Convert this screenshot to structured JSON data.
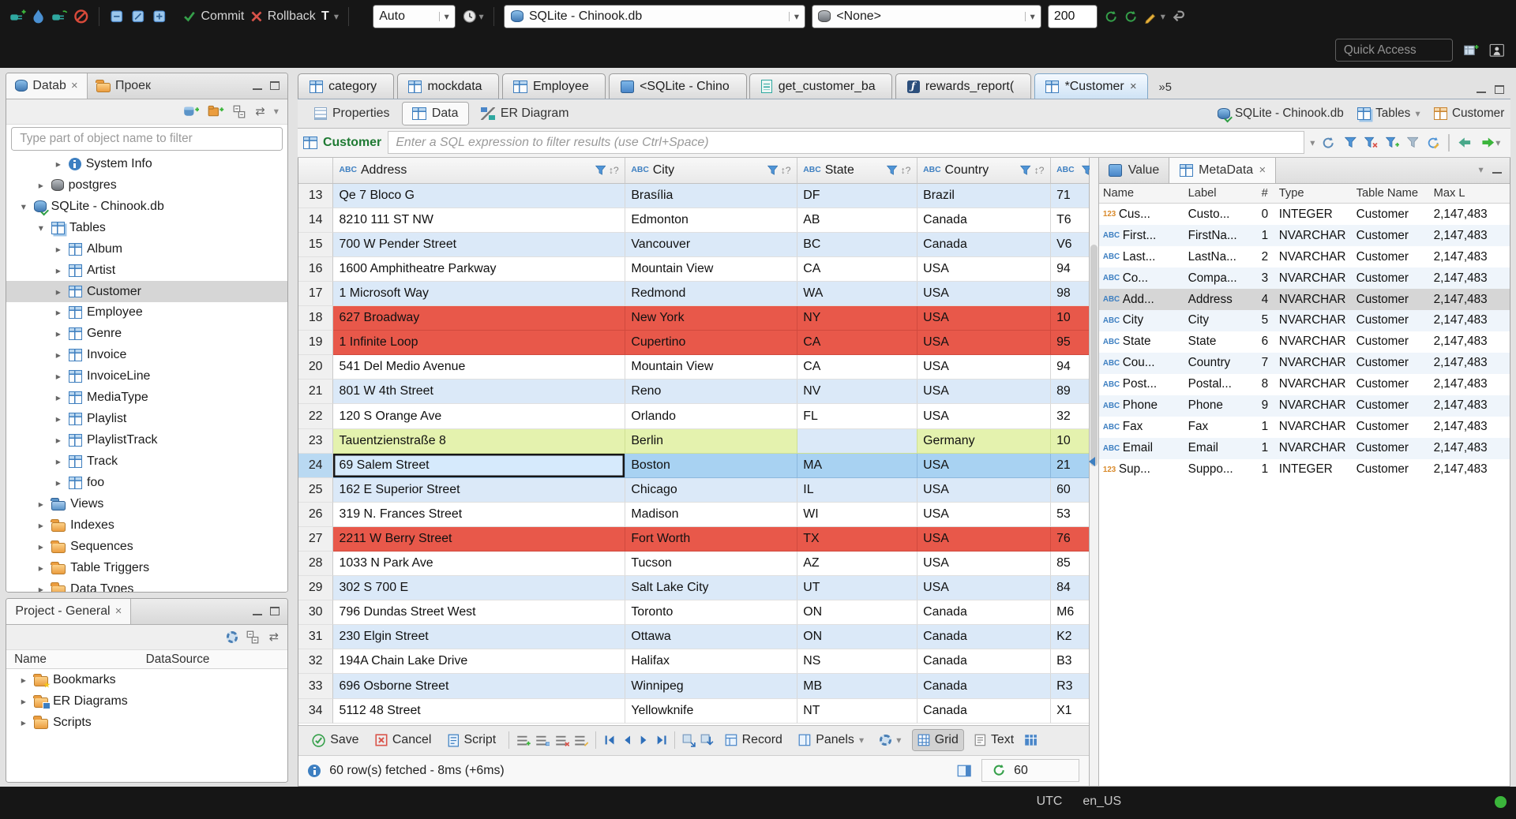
{
  "icons": {
    "chevron": "▾",
    "close": "×",
    "sort": "↕?",
    "link": "⇄"
  },
  "topbar": {
    "commit": "Commit",
    "rollback": "Rollback",
    "txn_letter": "T",
    "auto": "Auto",
    "db_combo": "SQLite - Chinook.db",
    "schema_combo": "<None>",
    "fetch_size": "200",
    "quick_access": "Quick Access"
  },
  "navigator": {
    "tab_database": "Datab",
    "tab_projects": "Проек",
    "filter_placeholder": "Type part of object name to filter",
    "tree": [
      {
        "label": "System Info",
        "arrow": "▸",
        "icon": "ic-info",
        "lvl": "lvl3"
      },
      {
        "label": "postgres",
        "arrow": "▸",
        "icon": "ic-db-gray",
        "lvl": "lvl2"
      },
      {
        "label": "SQLite - Chinook.db",
        "arrow": "▾",
        "icon": "ic-db-main",
        "lvl": "lvl1"
      },
      {
        "label": "Tables",
        "arrow": "▾",
        "icon": "ic-tables",
        "lvl": "lvl2"
      },
      {
        "label": "Album",
        "arrow": "▸",
        "icon": "ic-table",
        "lvl": "lvl3"
      },
      {
        "label": "Artist",
        "arrow": "▸",
        "icon": "ic-table",
        "lvl": "lvl3"
      },
      {
        "label": "Customer",
        "arrow": "▸",
        "icon": "ic-table",
        "lvl": "lvl3",
        "state": "sel"
      },
      {
        "label": "Employee",
        "arrow": "▸",
        "icon": "ic-table",
        "lvl": "lvl3"
      },
      {
        "label": "Genre",
        "arrow": "▸",
        "icon": "ic-table",
        "lvl": "lvl3"
      },
      {
        "label": "Invoice",
        "arrow": "▸",
        "icon": "ic-table",
        "lvl": "lvl3"
      },
      {
        "label": "InvoiceLine",
        "arrow": "▸",
        "icon": "ic-table",
        "lvl": "lvl3"
      },
      {
        "label": "MediaType",
        "arrow": "▸",
        "icon": "ic-table",
        "lvl": "lvl3"
      },
      {
        "label": "Playlist",
        "arrow": "▸",
        "icon": "ic-table",
        "lvl": "lvl3"
      },
      {
        "label": "PlaylistTrack",
        "arrow": "▸",
        "icon": "ic-table",
        "lvl": "lvl3"
      },
      {
        "label": "Track",
        "arrow": "▸",
        "icon": "ic-table",
        "lvl": "lvl3"
      },
      {
        "label": "foo",
        "arrow": "▸",
        "icon": "ic-table",
        "lvl": "lvl3"
      },
      {
        "label": "Views",
        "arrow": "▸",
        "icon": "ic-view",
        "lvl": "lvl2"
      },
      {
        "label": "Indexes",
        "arrow": "▸",
        "icon": "ic-folder",
        "lvl": "lvl2"
      },
      {
        "label": "Sequences",
        "arrow": "▸",
        "icon": "ic-folder",
        "lvl": "lvl2"
      },
      {
        "label": "Table Triggers",
        "arrow": "▸",
        "icon": "ic-folder",
        "lvl": "lvl2"
      },
      {
        "label": "Data Types",
        "arrow": "▸",
        "icon": "ic-folder",
        "lvl": "lvl2"
      }
    ]
  },
  "project": {
    "tab": "Project - General",
    "col_name": "Name",
    "col_datasource": "DataSource",
    "items": [
      {
        "label": "Bookmarks",
        "arrow": "▸",
        "icon": "ic-folder-star"
      },
      {
        "label": "ER Diagrams",
        "arrow": "▸",
        "icon": "ic-folder-er"
      },
      {
        "label": "Scripts",
        "arrow": "▸",
        "icon": "ic-folder"
      }
    ]
  },
  "editor": {
    "tabs": [
      {
        "label": "category",
        "icon": "ic-table"
      },
      {
        "label": "mockdata",
        "icon": "ic-table"
      },
      {
        "label": "Employee",
        "icon": "ic-table"
      },
      {
        "label": "<SQLite - Chino",
        "icon": "ic-sql"
      },
      {
        "label": "get_customer_ba",
        "icon": "ic-sqlfile"
      },
      {
        "label": "rewards_report(",
        "icon": "ic-func"
      },
      {
        "label": "*Customer",
        "icon": "ic-table",
        "state": "active",
        "close": "×"
      }
    ],
    "overflow": "»5",
    "subtabs": [
      {
        "label": "Properties",
        "icon": "ic-props"
      },
      {
        "label": "Data",
        "icon": "ic-data",
        "state": "active"
      },
      {
        "label": "ER Diagram",
        "icon": "ic-erd"
      }
    ],
    "breadcrumb": {
      "db": "SQLite - Chinook.db",
      "tables": "Tables",
      "entity": "Customer"
    },
    "filter": {
      "entity": "Customer",
      "placeholder": "Enter a SQL expression to filter results (use Ctrl+Space)"
    }
  },
  "grid": {
    "columns": [
      {
        "prefix": "ABC",
        "label": "Address",
        "cls": "c-addr"
      },
      {
        "prefix": "ABC",
        "label": "City",
        "cls": "c-city"
      },
      {
        "prefix": "ABC",
        "label": "State",
        "cls": "c-state"
      },
      {
        "prefix": "ABC",
        "label": "Country",
        "cls": "c-country"
      },
      {
        "prefix": "ABC",
        "label": "",
        "cls": "c-postal"
      }
    ],
    "rows": [
      {
        "num": "13",
        "address": "Qe 7 Bloco G",
        "city": "Brasília",
        "state": "DF",
        "country": "Brazil",
        "postal": "71"
      },
      {
        "num": "14",
        "address": "8210 111 ST NW",
        "city": "Edmonton",
        "state": "AB",
        "country": "Canada",
        "postal": "T6"
      },
      {
        "num": "15",
        "address": "700 W Pender Street",
        "city": "Vancouver",
        "state": "BC",
        "country": "Canada",
        "postal": "V6"
      },
      {
        "num": "16",
        "address": "1600 Amphitheatre Parkway",
        "city": "Mountain View",
        "state": "CA",
        "country": "USA",
        "postal": "94"
      },
      {
        "num": "17",
        "address": "1 Microsoft Way",
        "city": "Redmond",
        "state": "WA",
        "country": "USA",
        "postal": "98"
      },
      {
        "num": "18",
        "address": "627 Broadway",
        "city": "New York",
        "state": "NY",
        "country": "USA",
        "postal": "10",
        "rowstate": "red"
      },
      {
        "num": "19",
        "address": "1 Infinite Loop",
        "city": "Cupertino",
        "state": "CA",
        "country": "USA",
        "postal": "95",
        "rowstate": "red"
      },
      {
        "num": "20",
        "address": "541 Del Medio Avenue",
        "city": "Mountain View",
        "state": "CA",
        "country": "USA",
        "postal": "94"
      },
      {
        "num": "21",
        "address": "801 W 4th Street",
        "city": "Reno",
        "state": "NV",
        "country": "USA",
        "postal": "89"
      },
      {
        "num": "22",
        "address": "120 S Orange Ave",
        "city": "Orlando",
        "state": "FL",
        "country": "USA",
        "postal": "32"
      },
      {
        "num": "23",
        "address": "Tauentzienstraße 8",
        "city": "Berlin",
        "state": "",
        "country": "Germany",
        "postal": "10",
        "rowstate": "green"
      },
      {
        "num": "24",
        "address": "69 Salem Street",
        "city": "Boston",
        "state": "MA",
        "country": "USA",
        "postal": "21",
        "rowstate": "sel"
      },
      {
        "num": "25",
        "address": "162 E Superior Street",
        "city": "Chicago",
        "state": "IL",
        "country": "USA",
        "postal": "60"
      },
      {
        "num": "26",
        "address": "319 N. Frances Street",
        "city": "Madison",
        "state": "WI",
        "country": "USA",
        "postal": "53"
      },
      {
        "num": "27",
        "address": "2211 W Berry Street",
        "city": "Fort Worth",
        "state": "TX",
        "country": "USA",
        "postal": "76",
        "rowstate": "red"
      },
      {
        "num": "28",
        "address": "1033 N Park Ave",
        "city": "Tucson",
        "state": "AZ",
        "country": "USA",
        "postal": "85"
      },
      {
        "num": "29",
        "address": "302 S 700 E",
        "city": "Salt Lake City",
        "state": "UT",
        "country": "USA",
        "postal": "84"
      },
      {
        "num": "30",
        "address": "796 Dundas Street West",
        "city": "Toronto",
        "state": "ON",
        "country": "Canada",
        "postal": "M6"
      },
      {
        "num": "31",
        "address": "230 Elgin Street",
        "city": "Ottawa",
        "state": "ON",
        "country": "Canada",
        "postal": "K2"
      },
      {
        "num": "32",
        "address": "194A Chain Lake Drive",
        "city": "Halifax",
        "state": "NS",
        "country": "Canada",
        "postal": "B3"
      },
      {
        "num": "33",
        "address": "696 Osborne Street",
        "city": "Winnipeg",
        "state": "MB",
        "country": "Canada",
        "postal": "R3"
      },
      {
        "num": "34",
        "address": "5112 48 Street",
        "city": "Yellowknife",
        "state": "NT",
        "country": "Canada",
        "postal": "X1"
      }
    ]
  },
  "side": {
    "tab_value": "Value",
    "tab_metadata": "MetaData",
    "columns": [
      {
        "label": "Name",
        "cls": "s-name"
      },
      {
        "label": "Label",
        "cls": "s-label"
      },
      {
        "label": "#",
        "cls": "s-num"
      },
      {
        "label": "Type",
        "cls": "s-type"
      },
      {
        "label": "Table Name",
        "cls": "s-table"
      },
      {
        "label": "Max L",
        "cls": "s-max"
      }
    ],
    "rows": [
      {
        "icon": "123",
        "iconcls": "n123",
        "name": "Cus...",
        "label": "Custo...",
        "num": "0",
        "type": "INTEGER",
        "table": "Customer",
        "max": "2,147,483"
      },
      {
        "icon": "ABC",
        "iconcls": "nabc",
        "name": "First...",
        "label": "FirstNa...",
        "num": "1",
        "type": "NVARCHAR",
        "table": "Customer",
        "max": "2,147,483"
      },
      {
        "icon": "ABC",
        "iconcls": "nabc",
        "name": "Last...",
        "label": "LastNa...",
        "num": "2",
        "type": "NVARCHAR",
        "table": "Customer",
        "max": "2,147,483"
      },
      {
        "icon": "ABC",
        "iconcls": "nabc",
        "name": "Co...",
        "label": "Compa...",
        "num": "3",
        "type": "NVARCHAR",
        "table": "Customer",
        "max": "2,147,483"
      },
      {
        "icon": "ABC",
        "iconcls": "nabc",
        "name": "Add...",
        "label": "Address",
        "num": "4",
        "type": "NVARCHAR",
        "table": "Customer",
        "max": "2,147,483",
        "rowstate": "sel"
      },
      {
        "icon": "ABC",
        "iconcls": "nabc",
        "name": "City",
        "label": "City",
        "num": "5",
        "type": "NVARCHAR",
        "table": "Customer",
        "max": "2,147,483"
      },
      {
        "icon": "ABC",
        "iconcls": "nabc",
        "name": "State",
        "label": "State",
        "num": "6",
        "type": "NVARCHAR",
        "table": "Customer",
        "max": "2,147,483"
      },
      {
        "icon": "ABC",
        "iconcls": "nabc",
        "name": "Cou...",
        "label": "Country",
        "num": "7",
        "type": "NVARCHAR",
        "table": "Customer",
        "max": "2,147,483"
      },
      {
        "icon": "ABC",
        "iconcls": "nabc",
        "name": "Post...",
        "label": "Postal...",
        "num": "8",
        "type": "NVARCHAR",
        "table": "Customer",
        "max": "2,147,483"
      },
      {
        "icon": "ABC",
        "iconcls": "nabc",
        "name": "Phone",
        "label": "Phone",
        "num": "9",
        "type": "NVARCHAR",
        "table": "Customer",
        "max": "2,147,483"
      },
      {
        "icon": "ABC",
        "iconcls": "nabc",
        "name": "Fax",
        "label": "Fax",
        "num": "1",
        "type": "NVARCHAR",
        "table": "Customer",
        "max": "2,147,483"
      },
      {
        "icon": "ABC",
        "iconcls": "nabc",
        "name": "Email",
        "label": "Email",
        "num": "1",
        "type": "NVARCHAR",
        "table": "Customer",
        "max": "2,147,483"
      },
      {
        "icon": "123",
        "iconcls": "n123",
        "name": "Sup...",
        "label": "Suppo...",
        "num": "1",
        "type": "INTEGER",
        "table": "Customer",
        "max": "2,147,483"
      }
    ]
  },
  "result_toolbar": {
    "save": "Save",
    "cancel": "Cancel",
    "script": "Script",
    "record": "Record",
    "panels": "Panels",
    "grid": "Grid",
    "text": "Text"
  },
  "result_status": {
    "fetched": "60 row(s) fetched - 8ms (+6ms)",
    "count": "60"
  },
  "statusbar": {
    "tz": "UTC",
    "locale": "en_US"
  }
}
